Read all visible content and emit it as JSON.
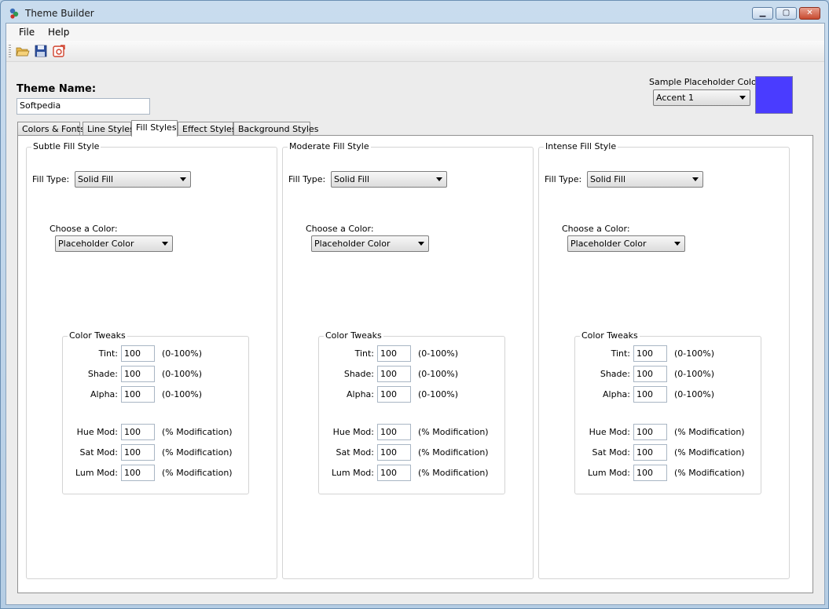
{
  "window": {
    "title": "Theme Builder"
  },
  "menu": {
    "file": "File",
    "help": "Help"
  },
  "toolbar": {
    "open_icon": "open-folder-icon",
    "save_icon": "save-disk-icon",
    "export_icon": "export-icon"
  },
  "theme": {
    "label": "Theme Name:",
    "value": "Softpedia"
  },
  "sample": {
    "label": "Sample Placeholder Color:",
    "selected": "Accent 1",
    "swatch_color": "#4a3cff"
  },
  "tabs": [
    "Colors & Fonts",
    "Line Styles",
    "Fill Styles",
    "Effect Styles",
    "Background Styles"
  ],
  "active_tab": "Fill Styles",
  "fill_panels": [
    {
      "title": "Subtle Fill Style",
      "fill_type_label": "Fill Type:",
      "fill_type": "Solid Fill",
      "choose_color_label": "Choose a Color:",
      "color": "Placeholder Color",
      "tweaks_title": "Color Tweaks",
      "tweaks": [
        {
          "label": "Tint:",
          "value": "100",
          "unit": "(0-100%)"
        },
        {
          "label": "Shade:",
          "value": "100",
          "unit": "(0-100%)"
        },
        {
          "label": "Alpha:",
          "value": "100",
          "unit": "(0-100%)"
        },
        {
          "label": "Hue Mod:",
          "value": "100",
          "unit": "(% Modification)"
        },
        {
          "label": "Sat Mod:",
          "value": "100",
          "unit": "(% Modification)"
        },
        {
          "label": "Lum Mod:",
          "value": "100",
          "unit": "(% Modification)"
        }
      ]
    },
    {
      "title": "Moderate Fill Style",
      "fill_type_label": "Fill Type:",
      "fill_type": "Solid Fill",
      "choose_color_label": "Choose a Color:",
      "color": "Placeholder Color",
      "tweaks_title": "Color Tweaks",
      "tweaks": [
        {
          "label": "Tint:",
          "value": "100",
          "unit": "(0-100%)"
        },
        {
          "label": "Shade:",
          "value": "100",
          "unit": "(0-100%)"
        },
        {
          "label": "Alpha:",
          "value": "100",
          "unit": "(0-100%)"
        },
        {
          "label": "Hue Mod:",
          "value": "100",
          "unit": "(% Modification)"
        },
        {
          "label": "Sat Mod:",
          "value": "100",
          "unit": "(% Modification)"
        },
        {
          "label": "Lum Mod:",
          "value": "100",
          "unit": "(% Modification)"
        }
      ]
    },
    {
      "title": "Intense Fill Style",
      "fill_type_label": "Fill Type:",
      "fill_type": "Solid Fill",
      "choose_color_label": "Choose a Color:",
      "color": "Placeholder Color",
      "tweaks_title": "Color Tweaks",
      "tweaks": [
        {
          "label": "Tint:",
          "value": "100",
          "unit": "(0-100%)"
        },
        {
          "label": "Shade:",
          "value": "100",
          "unit": "(0-100%)"
        },
        {
          "label": "Alpha:",
          "value": "100",
          "unit": "(0-100%)"
        },
        {
          "label": "Hue Mod:",
          "value": "100",
          "unit": "(% Modification)"
        },
        {
          "label": "Sat Mod:",
          "value": "100",
          "unit": "(% Modification)"
        },
        {
          "label": "Lum Mod:",
          "value": "100",
          "unit": "(% Modification)"
        }
      ]
    }
  ]
}
